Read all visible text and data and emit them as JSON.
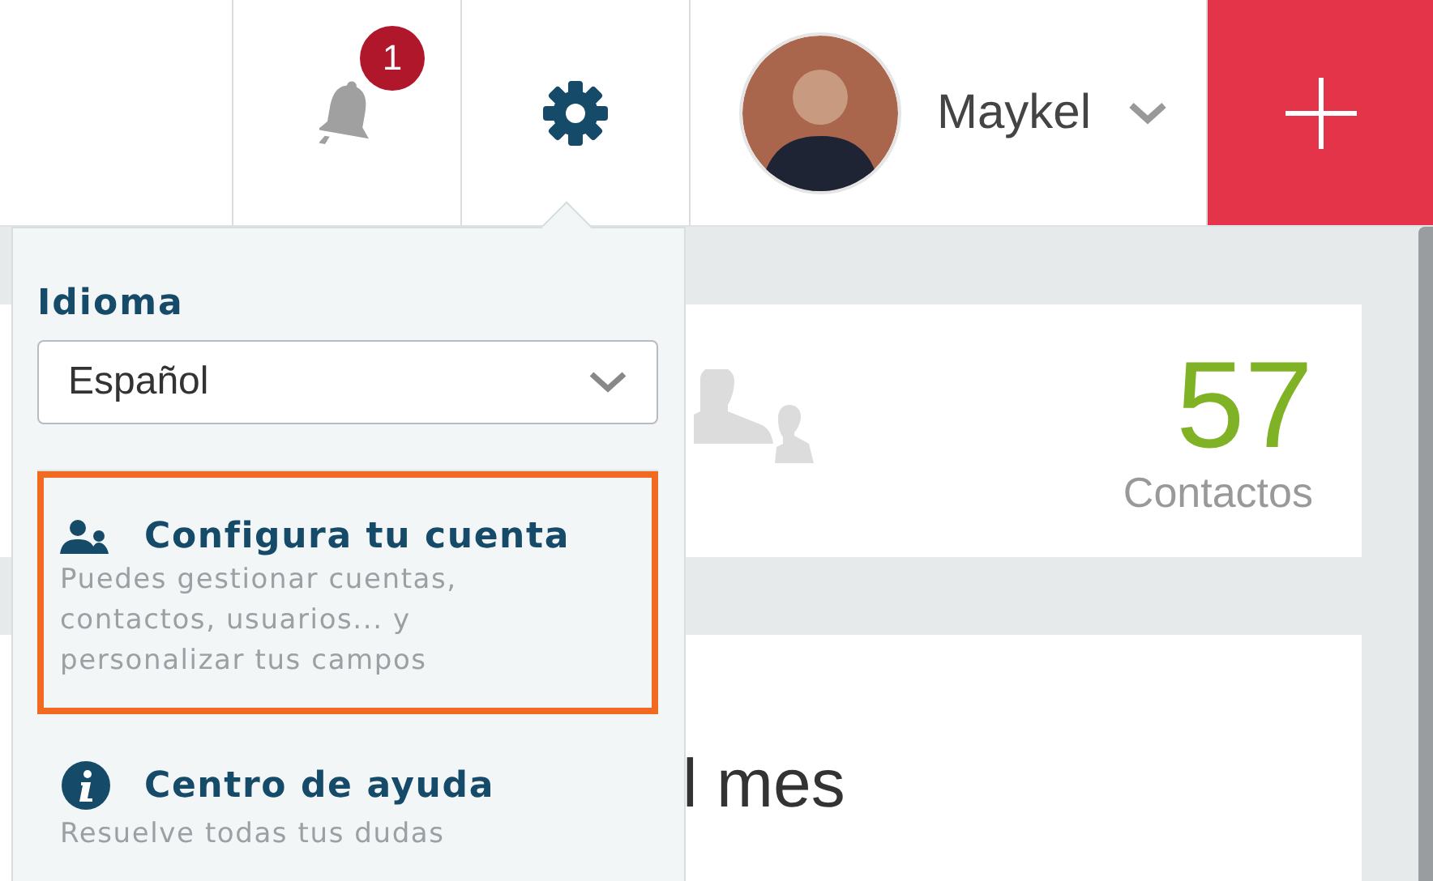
{
  "header": {
    "notifications": {
      "badge": "1"
    },
    "user": {
      "name": "Maykel"
    }
  },
  "settings_menu": {
    "language_label": "Idioma",
    "language_select": {
      "value": "Español"
    },
    "items": [
      {
        "kind": "account",
        "title": "Configura tu cuenta",
        "description": "Puedes gestionar cuentas, contactos, usuarios... y personalizar tus campos",
        "highlighted": true
      },
      {
        "kind": "help",
        "title": "Centro de ayuda",
        "description": "Resuelve todas tus dudas",
        "highlighted": false
      }
    ]
  },
  "stats_card": {
    "value": "57",
    "label": "Contactos"
  },
  "chart_card": {
    "title": "l mes"
  }
}
